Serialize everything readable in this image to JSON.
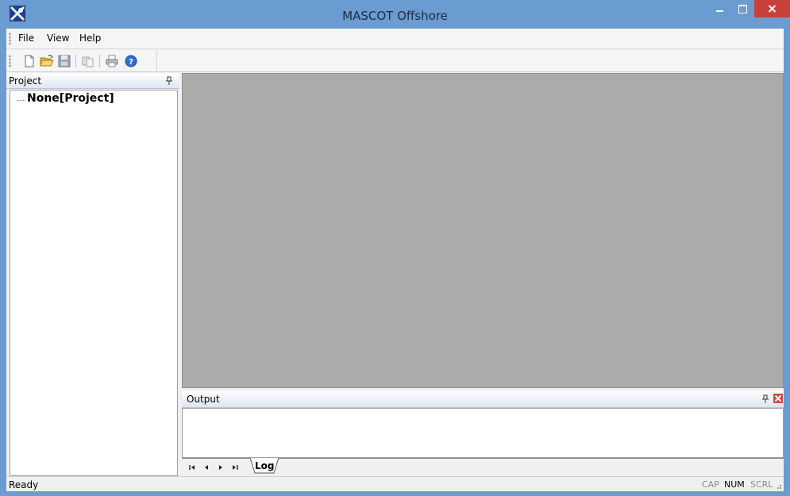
{
  "window": {
    "title": "MASCOT Offshore"
  },
  "menu": {
    "items": [
      "File",
      "View",
      "Help"
    ]
  },
  "toolbar": {
    "buttons": [
      "new-document-icon",
      "open-folder-icon",
      "save-icon",
      "copy-icon",
      "print-icon",
      "help-icon"
    ]
  },
  "project": {
    "title": "Project",
    "root_node": "None[Project]"
  },
  "output": {
    "title": "Output",
    "tab": "Log"
  },
  "status": {
    "text": "Ready",
    "indicators": [
      "CAP",
      "NUM",
      "SCRL"
    ],
    "active": "NUM"
  },
  "colors": {
    "titlebar": "#6a9bd1",
    "close": "#c7413a",
    "workspace": "#ababab"
  }
}
